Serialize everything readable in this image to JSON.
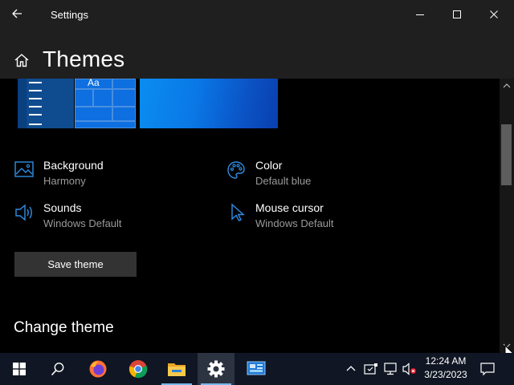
{
  "window": {
    "title": "Settings",
    "controls": [
      "minimize",
      "maximize",
      "close"
    ]
  },
  "header": {
    "page_title": "Themes"
  },
  "preview": {
    "tile_text": "Aa"
  },
  "settings_items": [
    {
      "title": "Background",
      "value": "Harmony",
      "icon": "picture-icon"
    },
    {
      "title": "Color",
      "value": "Default blue",
      "icon": "palette-icon"
    },
    {
      "title": "Sounds",
      "value": "Windows Default",
      "icon": "speaker-icon"
    },
    {
      "title": "Mouse cursor",
      "value": "Windows Default",
      "icon": "cursor-icon"
    }
  ],
  "buttons": {
    "save_theme": "Save theme"
  },
  "sections": {
    "change_theme": "Change theme"
  },
  "taskbar": {
    "apps": [
      "windows-start-icon",
      "search-icon",
      "firefox-icon",
      "chrome-icon",
      "file-explorer-icon",
      "settings-icon",
      "remote-desktop-icon"
    ],
    "active_app": "settings-icon",
    "tray_icons": [
      "chevron-up-icon",
      "security-icon",
      "network-icon",
      "volume-muted-icon"
    ],
    "time": "12:24 AM",
    "date": "3/23/2023"
  },
  "colors": {
    "accent": "#0078d7",
    "title_bar": "#1f1f1f",
    "content_bg": "#000000",
    "secondary_text": "#9a9a9a",
    "button_bg": "#333333",
    "taskbar": "#101623"
  }
}
